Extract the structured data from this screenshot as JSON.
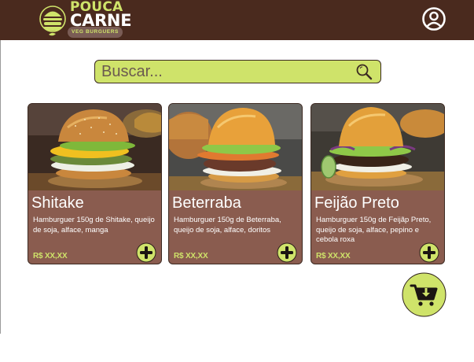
{
  "brand": {
    "line1": "POUCA",
    "line2": "CARNE",
    "tagline": "VEG BURGUERS"
  },
  "search": {
    "placeholder": "Buscar..."
  },
  "colors": {
    "header": "#4a2a1e",
    "accent": "#cfe36a",
    "card": "#8a5c4f"
  },
  "icons": {
    "profile": "user-circle-icon",
    "search": "magnifier-icon",
    "add": "plus-circle-icon",
    "cart": "cart-download-icon"
  },
  "products": [
    {
      "name": "Shitake",
      "description": "Hamburguer 150g de Shitake, queijo de soja, alface, manga",
      "price": "R$ XX,XX"
    },
    {
      "name": "Beterraba",
      "description": "Hamburguer 150g de Beterraba, queijo de soja, alface, doritos",
      "price": "R$ XX,XX"
    },
    {
      "name": "Feijão Preto",
      "description": "Hamburguer 150g de Feijãp Preto, queijo de soja, alface, pepino e cebola roxa",
      "price": "R$ XX,XX"
    }
  ]
}
